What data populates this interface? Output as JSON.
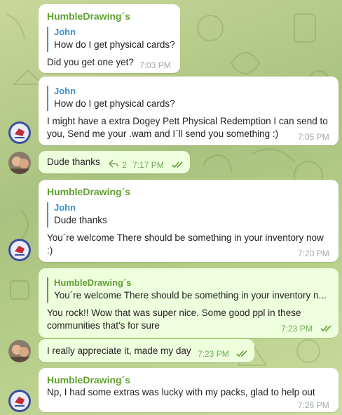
{
  "colors": {
    "incoming_bg": "#ffffff",
    "outgoing_bg": "#eeffde",
    "sender_name": "#5fa030",
    "reply_name": "#3a8fd0"
  },
  "messages": [
    {
      "sender": "HumbleDrawing´s",
      "reply_name": "John",
      "reply_text": "How do I get physical cards?",
      "lines": [
        "Did you get one yet?"
      ],
      "time": "7:03 PM"
    },
    {
      "reply_name": "John",
      "reply_text": "How do I get physical cards?",
      "lines": [
        "I might have a extra Dogey Pett Physical Redemption I can send to",
        "you, Send me your .wam and I´ll send you something :)"
      ],
      "time": "7:05 PM"
    },
    {
      "lines": [
        "Dude thanks"
      ],
      "replies_count": "2",
      "time": "7:17 PM"
    },
    {
      "sender": "HumbleDrawing´s",
      "reply_name": "John",
      "reply_text": "Dude thanks",
      "lines": [
        "You´re welcome There should be something in your inventory now",
        ":)"
      ],
      "time": "7:20 PM"
    },
    {
      "reply_name": "HumbleDrawing´s",
      "reply_text": "You´re welcome There should be something in your inventory n...",
      "lines": [
        "You rock!! Wow that was super nice. Some good ppl in these",
        "communities that's for sure"
      ],
      "time": "7:23 PM"
    },
    {
      "lines": [
        "I really appreciate it, made my day"
      ],
      "time": "7:23 PM"
    },
    {
      "sender": "HumbleDrawing´s",
      "lines": [
        "Np, I had some extras was lucky with my packs, glad to help out"
      ],
      "time": "7:26 PM"
    }
  ]
}
